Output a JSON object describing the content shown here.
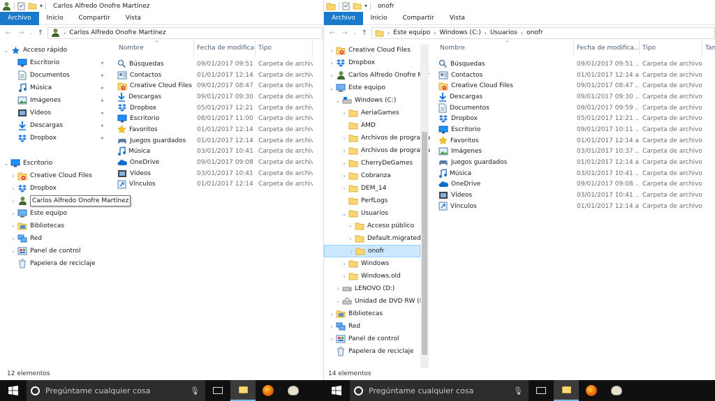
{
  "left": {
    "title": "Carlos Alfredo Onofre Martínez",
    "ribbon": [
      "Archivo",
      "Inicio",
      "Compartir",
      "Vista"
    ],
    "path": [
      "Carlos Alfredo Onofre Martínez"
    ],
    "nav": [
      {
        "label": "Acceso rápido",
        "icon": "star-icon",
        "exp": "⌄",
        "indent": 0,
        "pin": false
      },
      {
        "label": "Escritorio",
        "icon": "desktop-icon",
        "exp": "",
        "indent": 1,
        "pin": true
      },
      {
        "label": "Documentos",
        "icon": "documents-icon",
        "exp": "",
        "indent": 1,
        "pin": true
      },
      {
        "label": "Música",
        "icon": "music-icon",
        "exp": "",
        "indent": 1,
        "pin": true
      },
      {
        "label": "Imágenes",
        "icon": "pictures-icon",
        "exp": "",
        "indent": 1,
        "pin": true
      },
      {
        "label": "Vídeos",
        "icon": "videos-icon",
        "exp": "",
        "indent": 1,
        "pin": true
      },
      {
        "label": "Descargas",
        "icon": "downloads-icon",
        "exp": "",
        "indent": 1,
        "pin": true
      },
      {
        "label": "Dropbox",
        "icon": "dropbox-icon",
        "exp": "",
        "indent": 1,
        "pin": true
      },
      {
        "label": "",
        "icon": "",
        "exp": "",
        "indent": 0,
        "pin": false
      },
      {
        "label": "Escritorio",
        "icon": "desktop-icon",
        "exp": "⌄",
        "indent": 0,
        "pin": false
      },
      {
        "label": "Creative Cloud Files",
        "icon": "creative-cloud-icon",
        "exp": "›",
        "indent": 1,
        "pin": false
      },
      {
        "label": "Dropbox",
        "icon": "dropbox-icon",
        "exp": "›",
        "indent": 1,
        "pin": false
      },
      {
        "label": "Carlos Alfredo Onofre Martínez",
        "icon": "user-icon",
        "exp": "›",
        "indent": 1,
        "pin": false,
        "tooltip": true
      },
      {
        "label": "Este equipo",
        "icon": "computer-icon",
        "exp": "›",
        "indent": 1,
        "pin": false
      },
      {
        "label": "Bibliotecas",
        "icon": "libraries-icon",
        "exp": "›",
        "indent": 1,
        "pin": false
      },
      {
        "label": "Red",
        "icon": "network-icon",
        "exp": "›",
        "indent": 1,
        "pin": false
      },
      {
        "label": "Panel de control",
        "icon": "control-panel-icon",
        "exp": "›",
        "indent": 1,
        "pin": false
      },
      {
        "label": "Papelera de reciclaje",
        "icon": "recycle-bin-icon",
        "exp": "",
        "indent": 1,
        "pin": false
      }
    ],
    "columns": [
      "Nombre",
      "Fecha de modifica...",
      "Tipo"
    ],
    "files": [
      {
        "name": "Búsquedas",
        "date": "09/01/2017 09:51 ...",
        "type": "Carpeta de archivos",
        "icon": "search-icon"
      },
      {
        "name": "Contactos",
        "date": "01/01/2017 12:14 a...",
        "type": "Carpeta de archivos",
        "icon": "contacts-icon"
      },
      {
        "name": "Creative Cloud Files",
        "date": "09/01/2017 08:47 ...",
        "type": "Carpeta de archivos",
        "icon": "creative-cloud-icon"
      },
      {
        "name": "Descargas",
        "date": "09/01/2017 09:30 ...",
        "type": "Carpeta de archivos",
        "icon": "downloads-icon"
      },
      {
        "name": "Dropbox",
        "date": "05/01/2017 12:21 ...",
        "type": "Carpeta de archivos",
        "icon": "dropbox-icon"
      },
      {
        "name": "Escritorio",
        "date": "08/01/2017 11:00 ...",
        "type": "Carpeta de archivos",
        "icon": "desktop-icon"
      },
      {
        "name": "Favoritos",
        "date": "01/01/2017 12:14 a...",
        "type": "Carpeta de archivos",
        "icon": "favorites-icon"
      },
      {
        "name": "Juegos guardados",
        "date": "01/01/2017 12:14 a...",
        "type": "Carpeta de archivos",
        "icon": "saved-games-icon"
      },
      {
        "name": "Música",
        "date": "03/01/2017 10:41 ...",
        "type": "Carpeta de archivos",
        "icon": "music-icon"
      },
      {
        "name": "OneDrive",
        "date": "09/01/2017 09:08 ...",
        "type": "Carpeta de archivos",
        "icon": "onedrive-icon"
      },
      {
        "name": "Vídeos",
        "date": "03/01/2017 10:41 ...",
        "type": "Carpeta de archivos",
        "icon": "videos-icon"
      },
      {
        "name": "Vínculos",
        "date": "01/01/2017 12:14 a...",
        "type": "Carpeta de archivos",
        "icon": "links-icon"
      }
    ],
    "status": "12 elementos"
  },
  "right": {
    "title": "onofr",
    "ribbon": [
      "Archivo",
      "Inicio",
      "Compartir",
      "Vista"
    ],
    "path": [
      "Este equipo",
      "Windows (C:)",
      "Usuarios",
      "onofr"
    ],
    "nav": [
      {
        "label": "Creative Cloud Files",
        "icon": "creative-cloud-icon",
        "exp": "›",
        "indent": 0
      },
      {
        "label": "Dropbox",
        "icon": "dropbox-icon",
        "exp": "›",
        "indent": 0
      },
      {
        "label": "Carlos Alfredo Onofre Mar",
        "icon": "user-icon",
        "exp": "›",
        "indent": 0
      },
      {
        "label": "Este equipo",
        "icon": "computer-icon",
        "exp": "⌄",
        "indent": 0
      },
      {
        "label": "Windows (C:)",
        "icon": "drive-c-icon",
        "exp": "⌄",
        "indent": 1
      },
      {
        "label": "AeriaGames",
        "icon": "folder-icon",
        "exp": "›",
        "indent": 2
      },
      {
        "label": "AMD",
        "icon": "folder-icon",
        "exp": "",
        "indent": 2
      },
      {
        "label": "Archivos de programa",
        "icon": "folder-icon",
        "exp": "›",
        "indent": 2
      },
      {
        "label": "Archivos de programa",
        "icon": "folder-icon",
        "exp": "›",
        "indent": 2
      },
      {
        "label": "CherryDeGames",
        "icon": "folder-icon",
        "exp": "›",
        "indent": 2
      },
      {
        "label": "Cobranza",
        "icon": "folder-icon",
        "exp": "›",
        "indent": 2
      },
      {
        "label": "DEM_14",
        "icon": "folder-icon",
        "exp": "›",
        "indent": 2
      },
      {
        "label": "PerfLogs",
        "icon": "folder-icon",
        "exp": "",
        "indent": 2
      },
      {
        "label": "Usuarios",
        "icon": "folder-icon",
        "exp": "⌄",
        "indent": 2
      },
      {
        "label": "Acceso público",
        "icon": "folder-icon",
        "exp": "›",
        "indent": 3
      },
      {
        "label": "Default.migrated",
        "icon": "folder-icon",
        "exp": "›",
        "indent": 3
      },
      {
        "label": "onofr",
        "icon": "folder-icon",
        "exp": "›",
        "indent": 3,
        "selected": true
      },
      {
        "label": "Windows",
        "icon": "folder-icon",
        "exp": "›",
        "indent": 2
      },
      {
        "label": "Windows.old",
        "icon": "folder-icon",
        "exp": "›",
        "indent": 2
      },
      {
        "label": "LENOVO (D:)",
        "icon": "drive-icon",
        "exp": "›",
        "indent": 1
      },
      {
        "label": "Unidad de DVD RW (E:)",
        "icon": "dvd-drive-icon",
        "exp": "›",
        "indent": 1
      },
      {
        "label": "Bibliotecas",
        "icon": "libraries-icon",
        "exp": "›",
        "indent": 0
      },
      {
        "label": "Red",
        "icon": "network-icon",
        "exp": "›",
        "indent": 0
      },
      {
        "label": "Panel de control",
        "icon": "control-panel-icon",
        "exp": "›",
        "indent": 0
      },
      {
        "label": "Papelera de reciclaje",
        "icon": "recycle-bin-icon",
        "exp": "",
        "indent": 0
      }
    ],
    "columns": [
      "Nombre",
      "Fecha de modifica...",
      "Tipo",
      "Tama"
    ],
    "files": [
      {
        "name": "Búsquedas",
        "date": "09/01/2017 09:51 ...",
        "type": "Carpeta de archivos",
        "icon": "search-icon"
      },
      {
        "name": "Contactos",
        "date": "01/01/2017 12:14 a...",
        "type": "Carpeta de archivos",
        "icon": "contacts-icon"
      },
      {
        "name": "Creative Cloud Files",
        "date": "09/01/2017 08:47 ...",
        "type": "Carpeta de archivos",
        "icon": "creative-cloud-icon"
      },
      {
        "name": "Descargas",
        "date": "09/01/2017 09:30 ...",
        "type": "Carpeta de archivos",
        "icon": "downloads-icon"
      },
      {
        "name": "Documentos",
        "date": "09/01/2017 09:59 ...",
        "type": "Carpeta de archivos",
        "icon": "documents-icon"
      },
      {
        "name": "Dropbox",
        "date": "05/01/2017 12:21 ...",
        "type": "Carpeta de archivos",
        "icon": "dropbox-icon"
      },
      {
        "name": "Escritorio",
        "date": "09/01/2017 10:11 ...",
        "type": "Carpeta de archivos",
        "icon": "desktop-icon"
      },
      {
        "name": "Favoritos",
        "date": "01/01/2017 12:14 a...",
        "type": "Carpeta de archivos",
        "icon": "favorites-icon"
      },
      {
        "name": "Imágenes",
        "date": "03/01/2017 10:37 ...",
        "type": "Carpeta de archivos",
        "icon": "pictures-icon"
      },
      {
        "name": "Juegos guardados",
        "date": "01/01/2017 12:14 a...",
        "type": "Carpeta de archivos",
        "icon": "saved-games-icon"
      },
      {
        "name": "Música",
        "date": "03/01/2017 10:41 ...",
        "type": "Carpeta de archivos",
        "icon": "music-icon"
      },
      {
        "name": "OneDrive",
        "date": "09/01/2017 09:08 ...",
        "type": "Carpeta de archivos",
        "icon": "onedrive-icon"
      },
      {
        "name": "Vídeos",
        "date": "03/01/2017 10:41 ...",
        "type": "Carpeta de archivos",
        "icon": "videos-icon"
      },
      {
        "name": "Vínculos",
        "date": "01/01/2017 12:14 a...",
        "type": "Carpeta de archivos",
        "icon": "links-icon"
      }
    ],
    "status": "14 elementos",
    "scroll_fraction": 0.28
  },
  "taskbar": {
    "search_placeholder": "Pregúntame cualquier cosa",
    "apps": [
      "file-explorer-icon",
      "firefox-icon",
      "paint-icon"
    ],
    "colors": {
      "bg": "#101010",
      "search_bg": "#2d2d2d",
      "accent": "#76b9ed"
    }
  },
  "colors": {
    "ribbon_file": "#1979ca",
    "selection": "#cce8ff",
    "selection_border": "#99d1ff",
    "header_text": "#4c607a"
  }
}
